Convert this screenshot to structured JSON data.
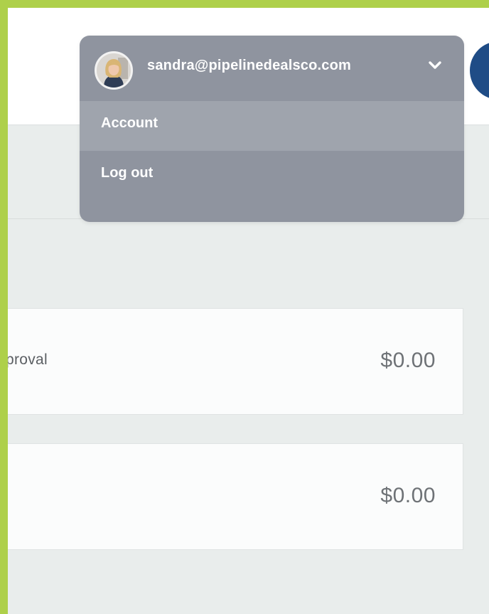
{
  "user_menu": {
    "email": "sandra@pipelinedealsco.com",
    "avatar_icon": "user-avatar-photo",
    "toggle_icon": "chevron-down-icon",
    "items": [
      {
        "label": "Account"
      },
      {
        "label": "Log out"
      }
    ]
  },
  "rows": [
    {
      "label": "proval",
      "amount": "$0.00"
    },
    {
      "label": "",
      "amount": "$0.00"
    }
  ],
  "colors": {
    "frame_border": "#aed04a",
    "menu_bg": "#8f949f",
    "menu_hover": "#9fa4ad",
    "circle_button": "#1f4c86"
  }
}
